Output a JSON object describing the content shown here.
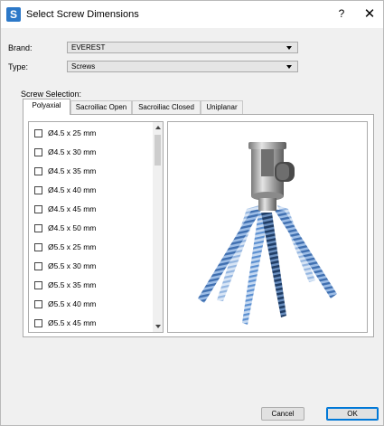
{
  "window": {
    "title": "Select Screw Dimensions",
    "help": "?",
    "close": "✕",
    "app_icon": "S"
  },
  "brand": {
    "label": "Brand:",
    "value": "EVEREST"
  },
  "type": {
    "label": "Type:",
    "value": "Screws"
  },
  "screw_selection": {
    "label": "Screw Selection:",
    "tabs": [
      "Polyaxial",
      "Sacroiliac Open",
      "Sacroiliac Closed",
      "Uniplanar"
    ],
    "active_tab": "Polyaxial",
    "items": [
      "Ø4.5 x 25 mm",
      "Ø4.5 x 30 mm",
      "Ø4.5 x 35 mm",
      "Ø4.5 x 40 mm",
      "Ø4.5 x 45 mm",
      "Ø4.5 x 50 mm",
      "Ø5.5 x 25 mm",
      "Ø5.5 x 30 mm",
      "Ø5.5 x 35 mm",
      "Ø5.5 x 40 mm",
      "Ø5.5 x 45 mm"
    ]
  },
  "buttons": {
    "cancel": "Cancel",
    "ok": "OK"
  },
  "icons": {
    "dropdown": "chevron-down-icon",
    "close": "close-icon",
    "help": "help-icon"
  },
  "colors": {
    "accent": "#0078d7",
    "screw_blue": "#5b8fd0",
    "screw_dark": "#1f3d66"
  }
}
